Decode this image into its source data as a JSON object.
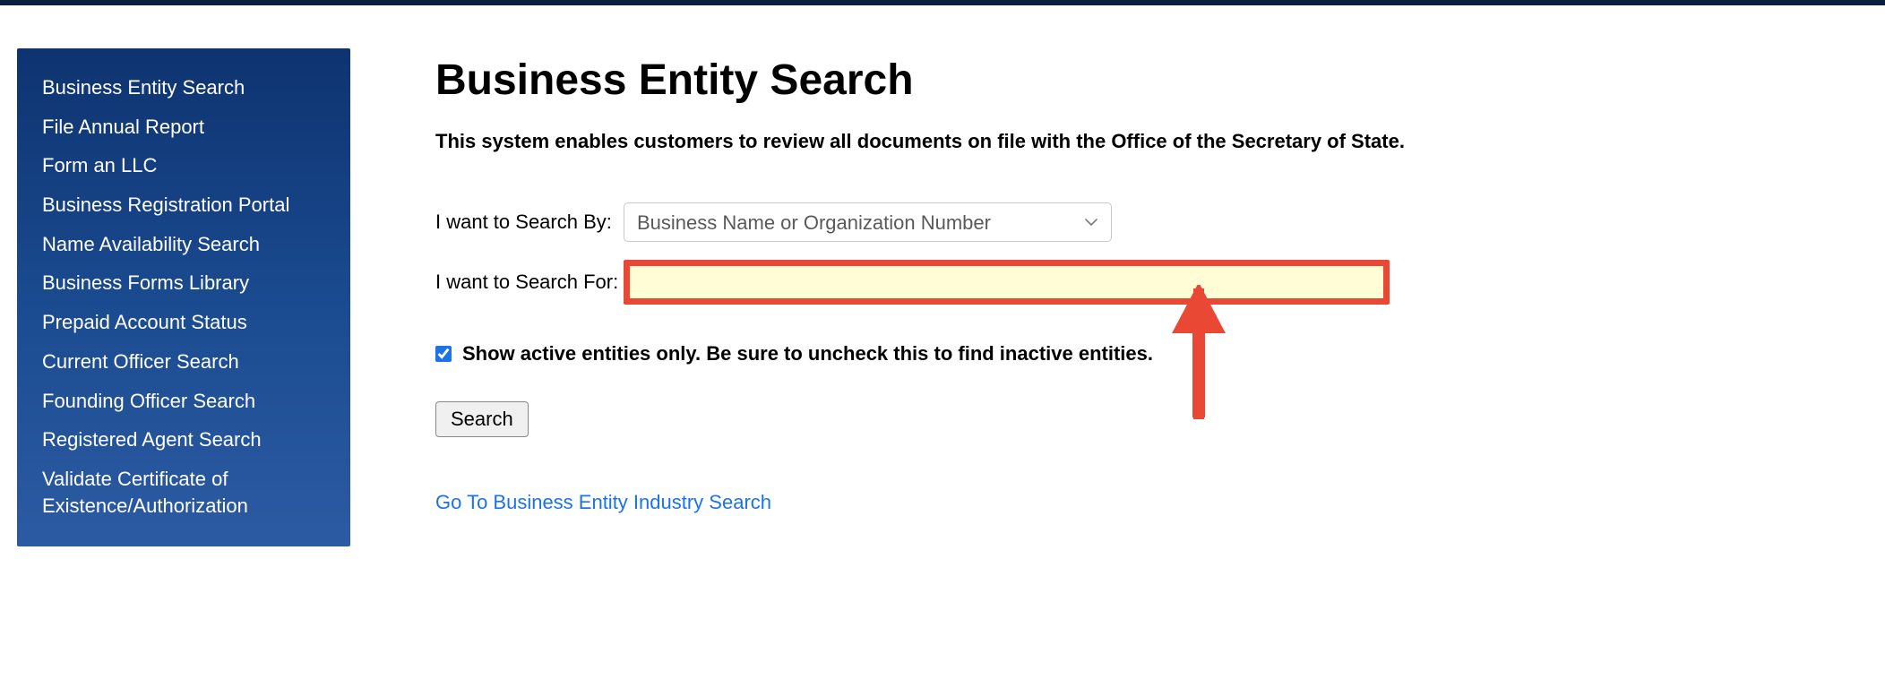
{
  "sidebar": {
    "items": [
      {
        "label": "Business Entity Search"
      },
      {
        "label": "File Annual Report"
      },
      {
        "label": "Form an LLC"
      },
      {
        "label": "Business Registration Portal"
      },
      {
        "label": "Name Availability Search"
      },
      {
        "label": "Business Forms Library"
      },
      {
        "label": "Prepaid Account Status"
      },
      {
        "label": "Current Officer Search"
      },
      {
        "label": "Founding Officer Search"
      },
      {
        "label": "Registered Agent Search"
      },
      {
        "label": "Validate Certificate of Existence/Authorization"
      }
    ]
  },
  "main": {
    "title": "Business Entity Search",
    "subtitle": "This system enables customers to review all documents on file with the Office of the Secretary of State.",
    "search_by_label": "I want to Search By:",
    "search_by_value": "Business Name or Organization Number",
    "search_for_label": "I want to Search For:",
    "search_for_value": "",
    "active_only_checked": true,
    "active_only_label": "Show active entities only. Be sure to uncheck this to find inactive entities.",
    "search_button_label": "Search",
    "industry_link_label": "Go To Business Entity Industry Search"
  },
  "annotation": {
    "arrow_color": "#e84834"
  }
}
